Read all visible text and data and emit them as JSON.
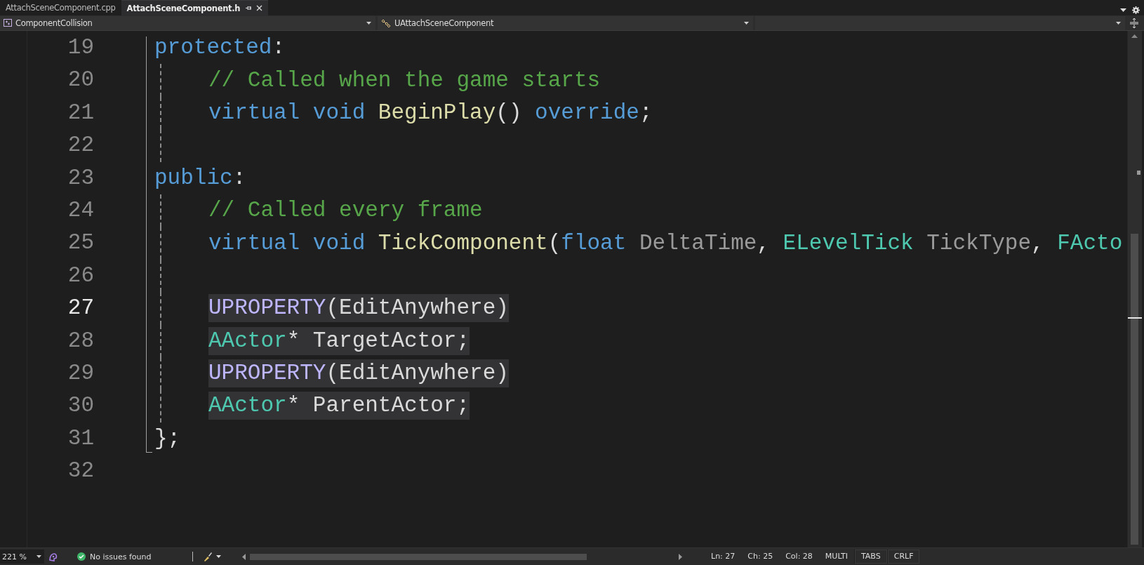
{
  "tabs": [
    {
      "label": "AttachSceneComponent.cpp",
      "selected": false
    },
    {
      "label": "AttachSceneComponent.h",
      "selected": true
    }
  ],
  "nav_bar": {
    "project": "ComponentCollision",
    "scope": "UAttachSceneComponent"
  },
  "editor": {
    "lines": [
      {
        "number": "19",
        "current": false,
        "indented": false,
        "highlighted": false,
        "tokens": [
          {
            "kind": "keyword",
            "text": "protected"
          },
          {
            "kind": "text",
            "text": ":"
          }
        ]
      },
      {
        "number": "20",
        "current": false,
        "indented": true,
        "highlighted": false,
        "tokens": [
          {
            "kind": "comment",
            "text": "// Called when the game starts"
          }
        ]
      },
      {
        "number": "21",
        "current": false,
        "indented": true,
        "highlighted": false,
        "tokens": [
          {
            "kind": "keyword",
            "text": "virtual void "
          },
          {
            "kind": "function",
            "text": "BeginPlay"
          },
          {
            "kind": "text",
            "text": "() "
          },
          {
            "kind": "keyword",
            "text": "override"
          },
          {
            "kind": "text",
            "text": ";"
          }
        ]
      },
      {
        "number": "22",
        "current": false,
        "indented": true,
        "highlighted": false
      },
      {
        "number": "23",
        "current": false,
        "indented": false,
        "highlighted": false,
        "tokens": [
          {
            "kind": "keyword",
            "text": "public"
          },
          {
            "kind": "text",
            "text": ":"
          }
        ]
      },
      {
        "number": "24",
        "current": false,
        "indented": true,
        "highlighted": false,
        "tokens": [
          {
            "kind": "comment",
            "text": "// Called every frame"
          }
        ]
      },
      {
        "number": "25",
        "current": false,
        "indented": true,
        "highlighted": false,
        "tokens": [
          {
            "kind": "keyword",
            "text": "virtual void "
          },
          {
            "kind": "function",
            "text": "TickComponent"
          },
          {
            "kind": "text",
            "text": "("
          },
          {
            "kind": "keyword",
            "text": "float "
          },
          {
            "kind": "param",
            "text": "DeltaTime"
          },
          {
            "kind": "text",
            "text": ", "
          },
          {
            "kind": "type",
            "text": "ELevelTick "
          },
          {
            "kind": "param",
            "text": "TickType"
          },
          {
            "kind": "text",
            "text": ", "
          },
          {
            "kind": "type",
            "text": "FActo"
          }
        ]
      },
      {
        "number": "26",
        "current": false,
        "indented": true,
        "highlighted": false
      },
      {
        "number": "27",
        "current": true,
        "indented": true,
        "highlighted": true,
        "tokens": [
          {
            "kind": "macro",
            "text": "UPROPERTY"
          },
          {
            "kind": "text",
            "text": "(EditAnywhere)"
          }
        ]
      },
      {
        "number": "28",
        "current": false,
        "indented": true,
        "highlighted": true,
        "tokens": [
          {
            "kind": "type",
            "text": "AActor"
          },
          {
            "kind": "text",
            "text": "* TargetActor;"
          }
        ]
      },
      {
        "number": "29",
        "current": false,
        "indented": true,
        "highlighted": true,
        "tokens": [
          {
            "kind": "macro",
            "text": "UPROPERTY"
          },
          {
            "kind": "text",
            "text": "(EditAnywhere)"
          }
        ]
      },
      {
        "number": "30",
        "current": false,
        "indented": true,
        "highlighted": true,
        "tokens": [
          {
            "kind": "type",
            "text": "AActor"
          },
          {
            "kind": "text",
            "text": "* ParentActor;"
          }
        ]
      },
      {
        "number": "31",
        "current": false,
        "indented": false,
        "highlighted": false,
        "tokens": [
          {
            "kind": "text",
            "text": "};"
          }
        ]
      },
      {
        "number": "32",
        "current": false,
        "indented": false,
        "highlighted": false
      }
    ]
  },
  "status_bar": {
    "zoom": "221 %",
    "issues": "No issues found",
    "line": "Ln: 27",
    "char": "Ch: 25",
    "column": "Col: 28",
    "selection_mode": "MULTI",
    "indentation": "TABS",
    "line_endings": "CRLF"
  }
}
